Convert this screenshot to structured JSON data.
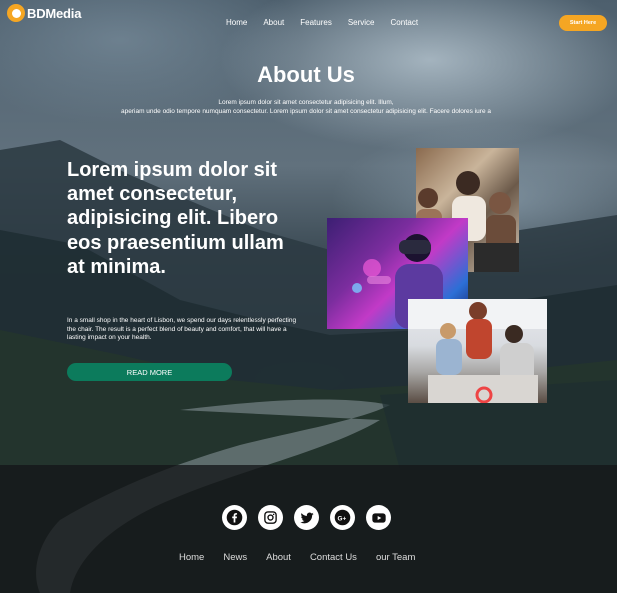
{
  "header": {
    "brand": "BDMedia",
    "nav": [
      "Home",
      "About",
      "Features",
      "Service",
      "Contact"
    ],
    "cta_label": "Start Here",
    "accent_color": "#f5a623"
  },
  "about": {
    "title": "About Us",
    "subtitle_line1": "Lorem ipsum dolor sit amet consectetur adipisicing elit. Illum,",
    "subtitle_line2": "aperiam unde odio tempore numquam consectetur. Lorem ipsum dolor sit amet consectetur adipisicing elit. Facere dolores iure a"
  },
  "hero": {
    "headline": "Lorem ipsum dolor sit amet consectetur, adipisicing elit. Libero eos praesentium ullam at minima.",
    "paragraph": "In a small shop in the heart of Lisbon, we spend our days relentlessly perfecting the chair. The result is a perfect blend of beauty and comfort, that will have a lasting impact on your health.",
    "button_label": "READ MORE",
    "button_color": "#0c7b5c"
  },
  "images": [
    {
      "description_icon": "team-meeting-photo"
    },
    {
      "description_icon": "vr-headset-photo"
    },
    {
      "description_icon": "office-team-photo"
    }
  ],
  "footer": {
    "socials": [
      "facebook-icon",
      "instagram-icon",
      "twitter-icon",
      "google-plus-icon",
      "youtube-icon"
    ],
    "nav": [
      "Home",
      "News",
      "About",
      "Contact Us",
      "our Team"
    ]
  }
}
